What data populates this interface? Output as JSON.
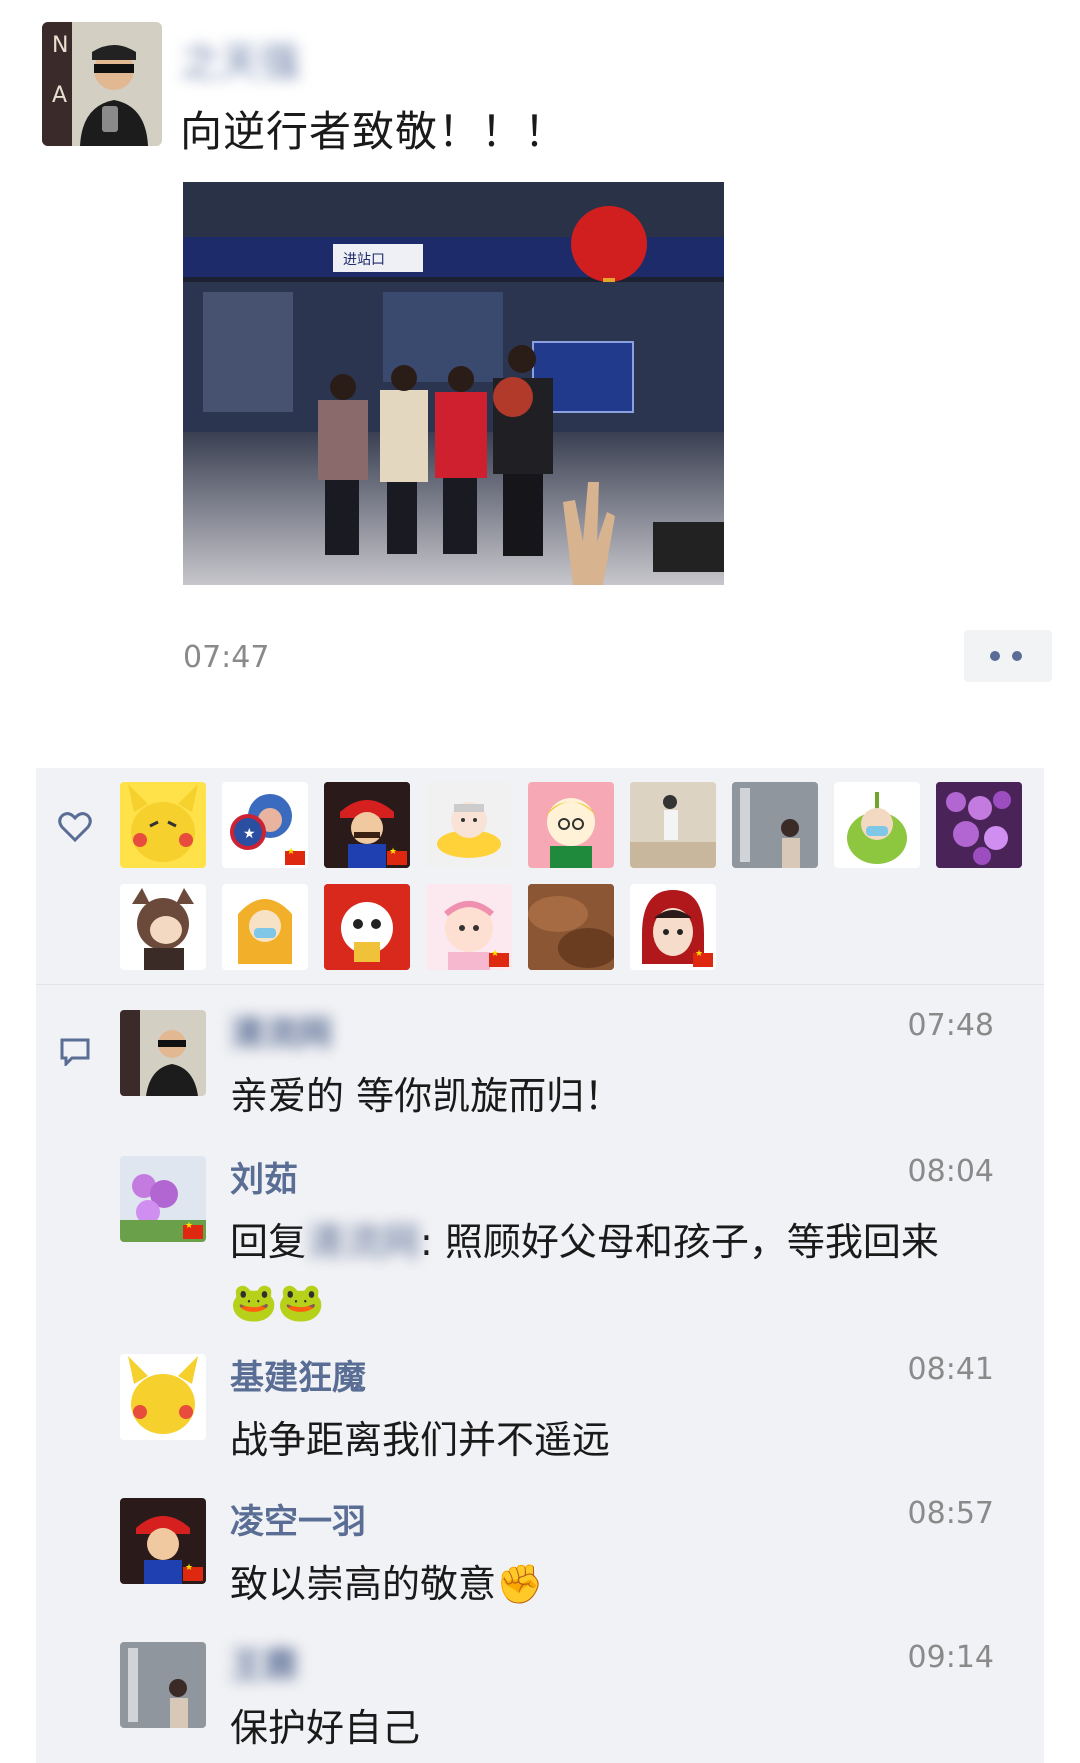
{
  "post": {
    "author": "之天强",
    "text": "向逆行者致敬！！！",
    "time": "07:47",
    "photo_sign": "进站口"
  },
  "likes": {
    "icon": "heart-icon",
    "count_avatars": 16
  },
  "comments": [
    {
      "name": "清流网",
      "time": "07:48",
      "text": "亲爱的 等你凯旋而归！"
    },
    {
      "name": "刘茹",
      "time": "08:04",
      "reply_prefix": "回复",
      "reply_target": "清流网",
      "text": ": 照顾好父母和孩子，等我回来",
      "emoji": "🐸🐸"
    },
    {
      "name": "基建狂魔",
      "time": "08:41",
      "text": "战争距离我们并不遥远"
    },
    {
      "name": "凌空一羽",
      "time": "08:57",
      "text": "致以崇高的敬意",
      "emoji": "✊"
    },
    {
      "name": "王霖",
      "time": "09:14",
      "text": "保护好自己"
    }
  ],
  "colors": {
    "link": "#5a6d94",
    "panel": "#f1f2f5",
    "time": "#8a8a8a"
  }
}
